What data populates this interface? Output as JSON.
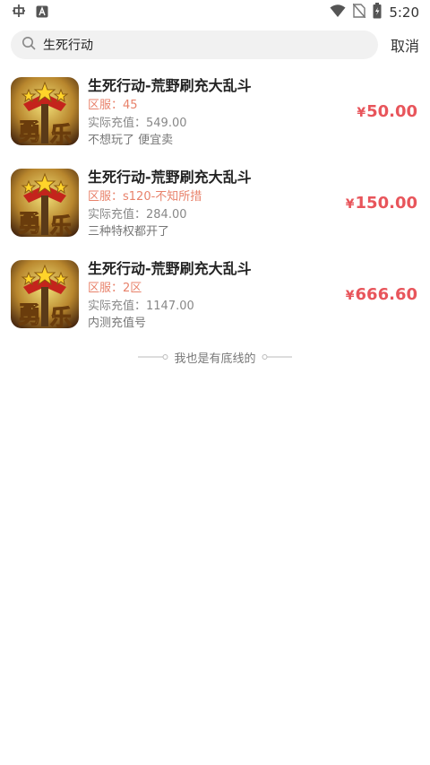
{
  "status_bar": {
    "time": "5:20",
    "icons": [
      "bug-icon",
      "keyboard-icon",
      "wifi-icon",
      "no-sim-icon",
      "battery-icon"
    ]
  },
  "search": {
    "query": "生死行动",
    "cancel_label": "取消"
  },
  "results": [
    {
      "title": "生死行动-荒野刷充大乱斗",
      "server": "区服：45",
      "recharge": "实际充值：549.00",
      "desc": "不想玩了 便宜卖",
      "currency": "¥",
      "price": "50.00"
    },
    {
      "title": "生死行动-荒野刷充大乱斗",
      "server": "区服：s120-不知所措",
      "recharge": "实际充值：284.00",
      "desc": "三种特权都开了",
      "currency": "¥",
      "price": "150.00"
    },
    {
      "title": "生死行动-荒野刷充大乱斗",
      "server": "区服：2区",
      "recharge": "实际充值：1147.00",
      "desc": "内测充值号",
      "currency": "¥",
      "price": "666.60"
    }
  ],
  "footer": {
    "text": "我也是有底线的"
  },
  "colors": {
    "price": "#e8555b",
    "server": "#e8826b",
    "search_bg": "#f1f1f1"
  }
}
